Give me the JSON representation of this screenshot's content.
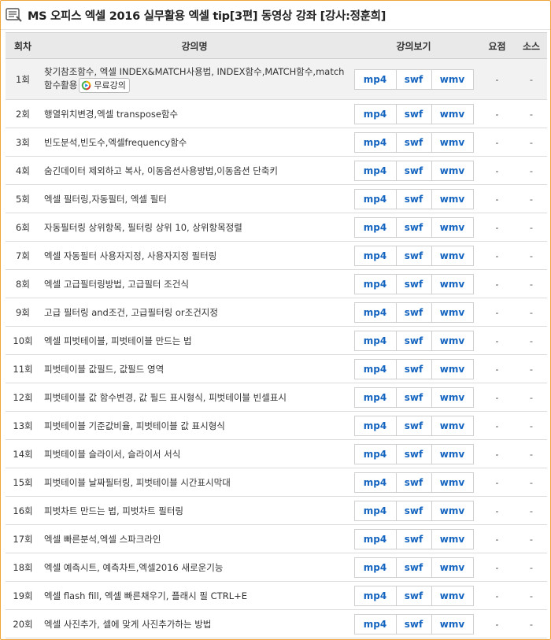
{
  "title": "MS 오피스 엑셀 2016 실무활용 엑셀 tip[3편] 동영상 강좌 [강사:정훈희]",
  "header": {
    "no": "회차",
    "name": "강의명",
    "view": "강의보기",
    "summary": "요점",
    "source": "소스"
  },
  "free_badge": "무료강의",
  "buttons": {
    "mp4": "mp4",
    "swf": "swf",
    "wmv": "wmv"
  },
  "lectures": [
    {
      "no": "1회",
      "name": "찾기참조함수, 엑셀 INDEX&MATCH사용법, INDEX함수,MATCH함수,match함수활용",
      "summary": "-",
      "source": "-"
    },
    {
      "no": "2회",
      "name": "행열위치변경,엑셀 transpose함수",
      "summary": "-",
      "source": "-"
    },
    {
      "no": "3회",
      "name": "빈도분석,빈도수,엑셀frequency함수",
      "summary": "-",
      "source": "-"
    },
    {
      "no": "4회",
      "name": "숨긴데이터 제외하고 복사, 이동옵션사용방법,이동옵션 단축키",
      "summary": "-",
      "source": "-"
    },
    {
      "no": "5회",
      "name": "엑셀 필터링,자동필터, 엑셀 필터",
      "summary": "-",
      "source": "-"
    },
    {
      "no": "6회",
      "name": "자동필터링 상위항목, 필터링 상위 10, 상위항목정렬",
      "summary": "-",
      "source": "-"
    },
    {
      "no": "7회",
      "name": "엑셀 자동필터 사용자지정, 사용자지정 필터링",
      "summary": "-",
      "source": "-"
    },
    {
      "no": "8회",
      "name": "엑셀 고급필터링방법, 고급필터 조건식",
      "summary": "-",
      "source": "-"
    },
    {
      "no": "9회",
      "name": "고급 필터링 and조건, 고급필터링 or조건지정",
      "summary": "-",
      "source": "-"
    },
    {
      "no": "10회",
      "name": "엑셀 피벗테이블, 피벗테이블 만드는 법",
      "summary": "-",
      "source": "-"
    },
    {
      "no": "11회",
      "name": "피벗테이블 값필드, 값필드 영역",
      "summary": "-",
      "source": "-"
    },
    {
      "no": "12회",
      "name": "피벗테이블 값 함수변경, 값 필드 표시형식, 피벗테이블 빈셀표시",
      "summary": "-",
      "source": "-"
    },
    {
      "no": "13회",
      "name": "피벗테이블 기준값비율, 피벗테이블 값 표시형식",
      "summary": "-",
      "source": "-"
    },
    {
      "no": "14회",
      "name": "피벗테이블 슬라이서, 슬라이서 서식",
      "summary": "-",
      "source": "-"
    },
    {
      "no": "15회",
      "name": "피벗테이블 날짜필터링, 피벗테이블 시간표시막대",
      "summary": "-",
      "source": "-"
    },
    {
      "no": "16회",
      "name": "피벗차트 만드는 법, 피벗차트 필터링",
      "summary": "-",
      "source": "-"
    },
    {
      "no": "17회",
      "name": "엑셀 빠른분석,엑셀 스파크라인",
      "summary": "-",
      "source": "-"
    },
    {
      "no": "18회",
      "name": "엑셀 예측시트, 예측차트,엑셀2016 새로운기능",
      "summary": "-",
      "source": "-"
    },
    {
      "no": "19회",
      "name": "엑셀 flash fill, 엑셀 빠른채우기, 플래시 필 CTRL+E",
      "summary": "-",
      "source": "-"
    },
    {
      "no": "20회",
      "name": "엑셀 사진추가, 셀에 맞게 사진추가하는 방법",
      "summary": "-",
      "source": "-"
    }
  ],
  "colors": {
    "frame": "#f0a43c",
    "header_bg": "#e9e9e9",
    "button_text": "#1565c0",
    "first_row_bg": "#f2f2f2"
  }
}
